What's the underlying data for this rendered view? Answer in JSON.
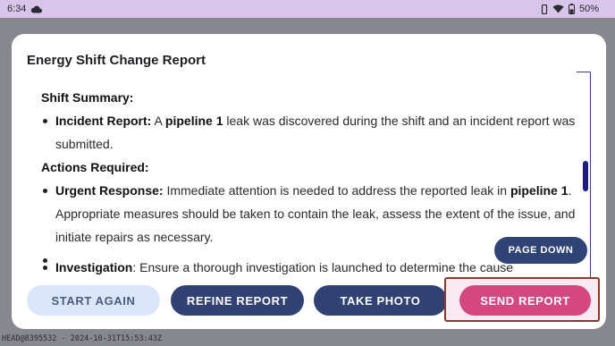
{
  "status_bar": {
    "time": "6:34",
    "battery": "50%",
    "icons": [
      "cloud-icon",
      "vibrate-icon",
      "wifi-icon",
      "battery-icon"
    ]
  },
  "dialog": {
    "title": "Energy Shift Change Report",
    "sections": {
      "summary_heading": "Shift Summary:",
      "incident_label": "Incident Report:",
      "incident_text_1": " A ",
      "incident_bold": "pipeline 1",
      "incident_text_2": " leak was discovered during the shift and an incident report was submitted.",
      "actions_heading": "Actions Required:",
      "urgent_label": "Urgent Response:",
      "urgent_text_1": " Immediate attention is needed to address the reported leak in ",
      "urgent_bold": "pipeline 1",
      "urgent_text_2": ". Appropriate measures should be taken to contain the leak, assess the extent of the issue, and initiate repairs as necessary.",
      "investigation_label": "Investigation",
      "investigation_text": ": Ensure a thorough investigation is launched to determine the cause"
    },
    "page_down_label": "PAGE DOWN"
  },
  "buttons": {
    "start_again": "START AGAIN",
    "refine_report": "REFINE REPORT",
    "take_photo": "TAKE PHOTO",
    "send_report": "SEND REPORT"
  },
  "footer": {
    "device_id": "HEAD@8395532 - 2024-10-31T15:53:43Z"
  },
  "colors": {
    "status_bar": "#d9c4ea",
    "primary_button": "#304274",
    "secondary_button": "#dbe6fb",
    "send_button": "#d4477f",
    "highlight_border": "#8a3a2a"
  }
}
